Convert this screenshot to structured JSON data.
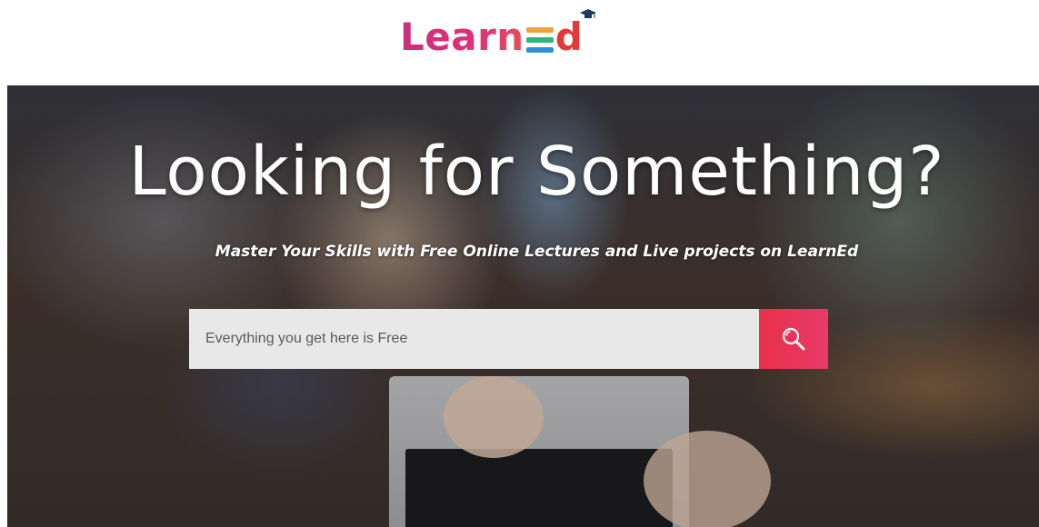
{
  "brand": {
    "logo_text_primary": "Learn",
    "logo_text_letter": "d",
    "colors": {
      "pink": "#d5317a",
      "red": "#e23a3a",
      "book_orange": "#f2a33a",
      "book_green": "#2fb57a",
      "book_blue": "#2d8fd6",
      "cap": "#1f3a5a"
    }
  },
  "hero": {
    "title": "Looking for Something?",
    "subtitle": "Master Your Skills with Free Online Lectures and Live projects on LearnEd"
  },
  "search": {
    "placeholder": "Everything you get here is Free",
    "button_icon": "search-icon",
    "button_color": "#e8304a"
  }
}
